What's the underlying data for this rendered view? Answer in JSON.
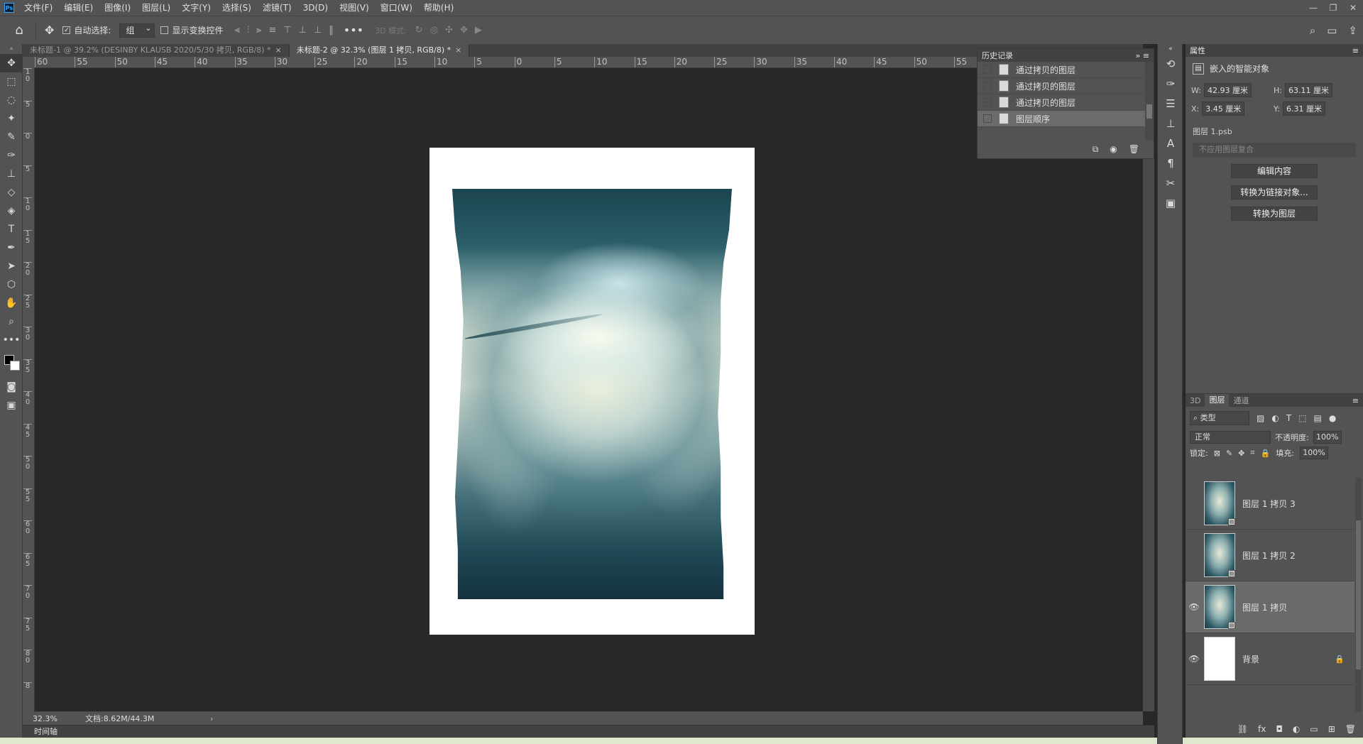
{
  "app": {
    "logo": "Ps",
    "menu": [
      "文件(F)",
      "编辑(E)",
      "图像(I)",
      "图层(L)",
      "文字(Y)",
      "选择(S)",
      "滤镜(T)",
      "3D(D)",
      "视图(V)",
      "窗口(W)",
      "帮助(H)"
    ],
    "window_controls": [
      "—",
      "❐",
      "✕"
    ]
  },
  "options_bar": {
    "auto_select_label": "自动选择:",
    "auto_select_checked": true,
    "auto_select_target": "组",
    "show_transform_label": "显示变换控件",
    "show_transform_checked": false,
    "mode_3d_label": "3D 模式:"
  },
  "tabs": [
    {
      "label": "未标题-1 @ 39.2% (DESINBY KLAUSB   2020/5/30 拷贝, RGB/8) *",
      "active": false
    },
    {
      "label": "未标题-2 @ 32.3% (图层 1 拷贝, RGB/8) *",
      "active": true
    }
  ],
  "rulers": {
    "h_labels": [
      "60",
      "55",
      "50",
      "45",
      "40",
      "35",
      "30",
      "25",
      "20",
      "15",
      "10",
      "5",
      "0",
      "5",
      "10",
      "15",
      "20",
      "25",
      "30",
      "35",
      "40",
      "45",
      "50",
      "55",
      "60",
      "65",
      "70",
      "75",
      "80"
    ],
    "v_labels": [
      "1\n0",
      "5",
      "0",
      "5",
      "1\n0",
      "1\n5",
      "2\n0",
      "2\n5",
      "3\n0",
      "3\n5",
      "4\n0",
      "4\n5",
      "5\n0",
      "5\n5",
      "6\n0",
      "6\n5",
      "7\n0",
      "7\n5",
      "8\n0",
      "8"
    ]
  },
  "status": {
    "zoom": "32.3%",
    "doc_size": "文档:8.62M/44.3M",
    "timeline_label": "时间轴"
  },
  "history": {
    "title": "历史记录",
    "items": [
      {
        "label": "通过拷贝的图层",
        "active": false
      },
      {
        "label": "通过拷贝的图层",
        "active": false
      },
      {
        "label": "通过拷贝的图层",
        "active": false
      },
      {
        "label": "图层顺序",
        "active": true
      }
    ]
  },
  "properties": {
    "title": "属性",
    "kind": "嵌入的智能对象",
    "w_label": "W:",
    "w_value": "42.93 厘米",
    "h_label": "H:",
    "h_value": "63.11 厘米",
    "x_label": "X:",
    "x_value": "3.45 厘米",
    "y_label": "Y:",
    "y_value": "6.31 厘米",
    "file": "图层 1.psb",
    "comp_placeholder": "不应用图层复合",
    "buttons": [
      "编辑内容",
      "转换为链接对象...",
      "转换为图层"
    ]
  },
  "layers_panel": {
    "tabs": [
      "3D",
      "图层",
      "通道"
    ],
    "active_tab": "图层",
    "filter_kind": "类型",
    "blend_mode": "正常",
    "opacity_label": "不透明度:",
    "opacity": "100%",
    "lock_label": "锁定:",
    "fill_label": "填充:",
    "fill": "100%",
    "layers": [
      {
        "name": "图层 1 拷贝 3",
        "visible": false,
        "selected": false,
        "smart": true
      },
      {
        "name": "图层 1 拷贝 2",
        "visible": false,
        "selected": false,
        "smart": true
      },
      {
        "name": "图层 1 拷贝",
        "visible": true,
        "selected": true,
        "smart": true
      },
      {
        "name": "背景",
        "visible": true,
        "selected": false,
        "smart": false,
        "locked": true
      }
    ]
  }
}
